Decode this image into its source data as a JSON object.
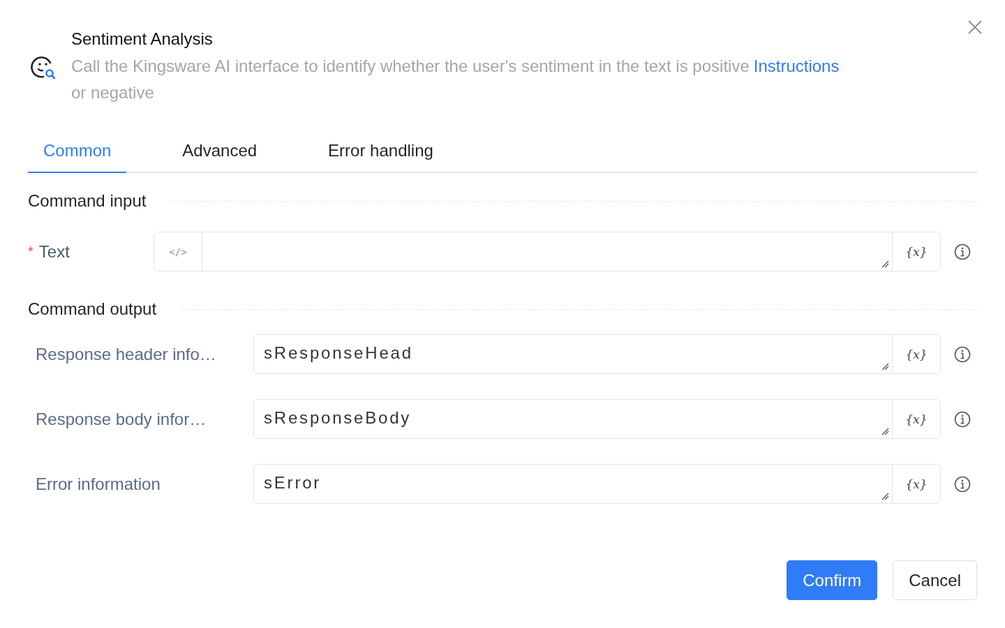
{
  "dialog": {
    "title": "Sentiment Analysis",
    "description": "Call the Kingsware AI interface to identify whether the user's sentiment in the text is positive or negative",
    "link": "Instructions"
  },
  "tabs": [
    {
      "label": "Common",
      "selected": true
    },
    {
      "label": "Advanced",
      "selected": false
    },
    {
      "label": "Error handling",
      "selected": false
    }
  ],
  "sections": [
    {
      "title": "Command input",
      "fields": [
        {
          "kind": "code",
          "label": "Text",
          "required_mark": "*",
          "prefix": "</>",
          "variable_button": "{x}"
        }
      ]
    },
    {
      "title": "Command output",
      "fields": [
        {
          "kind": "plain",
          "label": "Response header info…",
          "value": "sResponseHead",
          "variable_button": "{x}"
        },
        {
          "kind": "plain",
          "label": "Response body infor…",
          "value": "sResponseBody",
          "variable_button": "{x}"
        },
        {
          "kind": "plain",
          "label": "Error information",
          "value": "sError",
          "variable_button": "{x}"
        }
      ]
    }
  ],
  "buttons": [
    {
      "label": "Confirm",
      "kind": "primary"
    },
    {
      "label": "Cancel",
      "kind": "default"
    }
  ]
}
